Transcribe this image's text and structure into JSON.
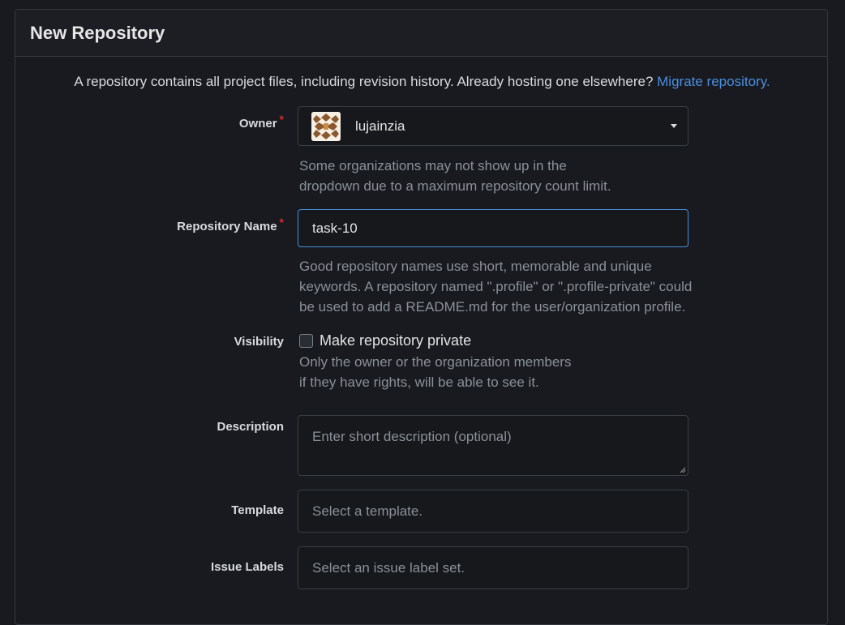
{
  "header": {
    "title": "New Repository"
  },
  "intro": {
    "text": "A repository contains all project files, including revision history. Already hosting one elsewhere?",
    "link": "Migrate repository."
  },
  "owner": {
    "label": "Owner",
    "required_mark": "*",
    "value": "lujainzia",
    "avatar_icon": "owner-avatar-icon",
    "help_line1": "Some organizations may not show up in the",
    "help_line2": "dropdown due to a maximum repository count limit."
  },
  "repo_name": {
    "label": "Repository Name",
    "required_mark": "*",
    "value": "task-10",
    "help_line1": "Good repository names use short, memorable and unique",
    "help_line2": "keywords. A repository named \".profile\" or \".profile-private\" could",
    "help_line3": "be used to add a README.md for the user/organization profile."
  },
  "visibility": {
    "label": "Visibility",
    "checkbox_label": "Make repository private",
    "checked": false,
    "help_line1": "Only the owner or the organization members",
    "help_line2": "if they have rights, will be able to see it."
  },
  "description": {
    "label": "Description",
    "placeholder": "Enter short description (optional)"
  },
  "template": {
    "label": "Template",
    "placeholder": "Select a template."
  },
  "issue_labels": {
    "label": "Issue Labels",
    "placeholder": "Select an issue label set."
  },
  "colors": {
    "accent": "#4a8ede",
    "required": "#db2828",
    "background": "#181a1f",
    "border": "#363a40"
  }
}
